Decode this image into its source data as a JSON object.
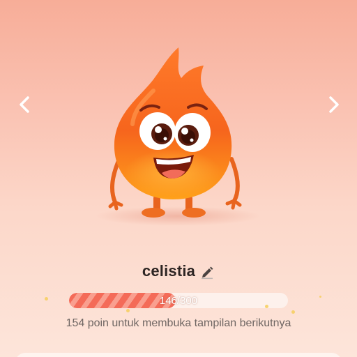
{
  "navigation": {
    "prev_icon": "chevron-left-icon",
    "next_icon": "chevron-right-icon"
  },
  "mascot": {
    "icon": "flame-mascot",
    "colors": {
      "flame_top": "#ff8a1f",
      "flame_bottom": "#f05a16",
      "limbs": "#e8641e"
    }
  },
  "profile": {
    "username": "celistia",
    "edit_icon": "pencil-icon"
  },
  "progress": {
    "current": 146,
    "max": 300,
    "fraction": 0.487,
    "label": "146/300"
  },
  "unlock_message": "154 poin untuk membuka tampilan berikutnya",
  "colors": {
    "progress_fill": "#f46b58",
    "progress_stripe": "#f99f8f",
    "progress_track": "#fdf1ec",
    "background_top": "#f7ad98",
    "background_bottom": "#fde5da"
  }
}
